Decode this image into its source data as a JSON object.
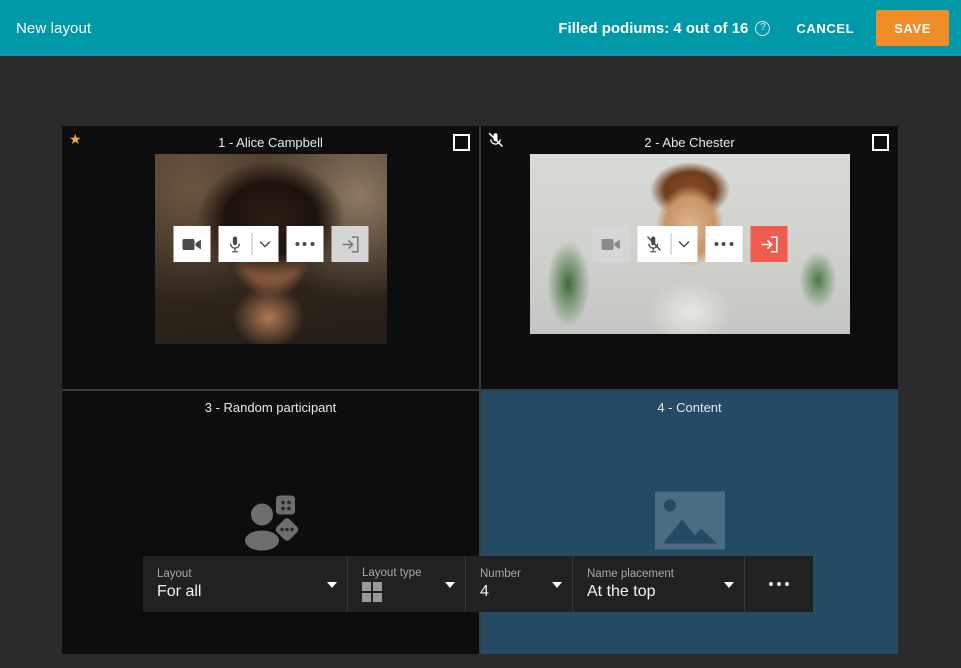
{
  "header": {
    "title": "New layout",
    "filled_podiums": "Filled podiums: 4 out of 16",
    "help_icon": "help-icon",
    "help_glyph": "?",
    "cancel_label": "CANCEL",
    "save_label": "SAVE",
    "bg_color": "#0099a8",
    "save_color": "#f28c28"
  },
  "podiums": [
    {
      "name": "1 - Alice Campbell",
      "badge": "star-icon",
      "badge_glyph": "★",
      "checkbox": "podium-select-checkbox",
      "camera_state": "on",
      "mic_state": "on",
      "leave_state": "default",
      "kind": "video"
    },
    {
      "name": "2 - Abe Chester",
      "badge": "mic-off-icon",
      "checkbox": "podium-select-checkbox",
      "camera_state": "off",
      "mic_state": "off",
      "leave_state": "active",
      "kind": "video"
    },
    {
      "name": "3 - Random participant",
      "kind": "random",
      "placeholder_icon": "random-participant-icon"
    },
    {
      "name": "4 - Content",
      "kind": "content",
      "placeholder_icon": "image-icon",
      "bg_color": "#254a63"
    }
  ],
  "toolbar": {
    "layout": {
      "label": "Layout",
      "value": "For all"
    },
    "layout_type": {
      "label": "Layout type",
      "value_icon": "grid-2x2-icon"
    },
    "number": {
      "label": "Number",
      "value": "4"
    },
    "name_placement": {
      "label": "Name placement",
      "value": "At the top"
    },
    "more": "more-options-icon"
  }
}
